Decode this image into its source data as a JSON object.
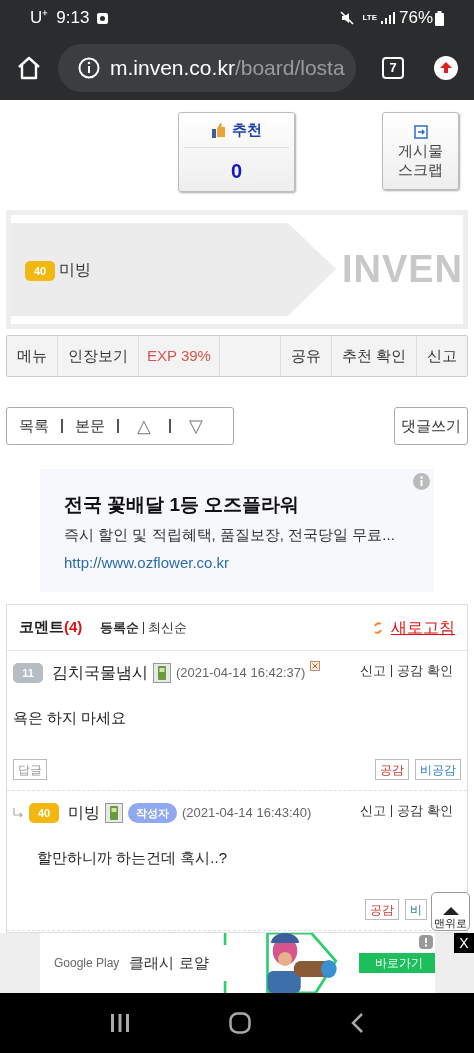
{
  "status_bar": {
    "carrier": "U⁺",
    "time": "9:13",
    "network": "LTE",
    "battery": "76%"
  },
  "browser": {
    "url_host": "m.inven.co.kr",
    "url_path": "/board/losta",
    "tab_count": "7"
  },
  "recommend": {
    "label": "추천",
    "count": "0"
  },
  "scrap": {
    "label": "게시물 스크랩"
  },
  "profile": {
    "level": "40",
    "name": "미빙",
    "logo": "INVEN"
  },
  "menu_bar": [
    {
      "label": "메뉴",
      "kind": "plain"
    },
    {
      "label": "인장보기",
      "kind": "plain"
    },
    {
      "label": "EXP 39%",
      "kind": "exp"
    },
    {
      "kind": "spacer"
    },
    {
      "label": "공유",
      "kind": "plain"
    },
    {
      "label": "추천 확인",
      "kind": "plain"
    },
    {
      "label": "신고",
      "kind": "plain"
    }
  ],
  "nav": {
    "items": [
      "목록",
      "본문",
      "△",
      "▽"
    ],
    "write": "댓글쓰기"
  },
  "ad": {
    "title": "전국 꽃배달 1등 오즈플라워",
    "text": "즉시 할인 및 적립혜택, 품질보장, 전국당일 무료...",
    "link": "http://www.ozflower.co.kr"
  },
  "comments": {
    "title": "코멘트",
    "count": "(4)",
    "sort": [
      {
        "label": "등록순",
        "selected": true
      },
      {
        "label": "최신순",
        "selected": false
      }
    ],
    "refresh": "새로고침",
    "items": [
      {
        "reply": false,
        "level": "11",
        "author": "김치국물냄시",
        "date": "(2021-04-14 16:42:37)",
        "deletable": true,
        "actions": [
          "신고",
          "공감 확인"
        ],
        "body": "욕은 하지 마세요",
        "reply_button": "답글",
        "like": "공감",
        "dislike": "비공감"
      },
      {
        "reply": true,
        "level": "40",
        "author": "미빙",
        "badge": "작성자",
        "date": "(2021-04-14 16:43:40)",
        "deletable": false,
        "actions": [
          "신고",
          "공감 확인"
        ],
        "body": "할만하니까 하는건데 혹시..?",
        "like": "공감",
        "dislike": "비"
      }
    ]
  },
  "top_button": "맨위로",
  "bottom_ad": {
    "store": "Google Play",
    "game": "클래시 로얄",
    "cta": "바로가기",
    "close": "X"
  }
}
